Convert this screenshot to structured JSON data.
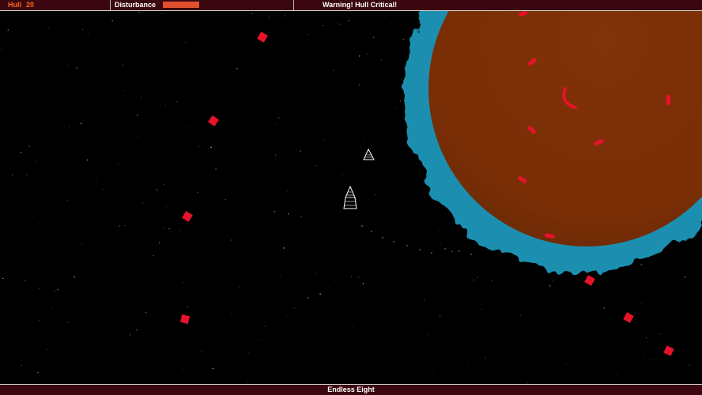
{
  "hud": {
    "hull_label": "Hull",
    "hull_value": "20",
    "disturbance_label": "Disturbance",
    "disturbance_level": 0.2,
    "warning": "Warning! Hull Critical!"
  },
  "footer": {
    "level_name": "Endless Eight"
  },
  "colors": {
    "hud_bg": "#3a0710",
    "hull_text": "#ff6a1a",
    "disturbance_bar": "#e0502e",
    "planet_core": "#7a2e06",
    "planet_rim": "#1e8fb0",
    "enemy": "#e8122a",
    "ship_outline": "#ffffff"
  },
  "sprites": {
    "player": "player-ship-icon",
    "drone": "drone-ship-icon",
    "enemy": "red-diamond-enemy-icon",
    "planet": "planet-icon"
  }
}
